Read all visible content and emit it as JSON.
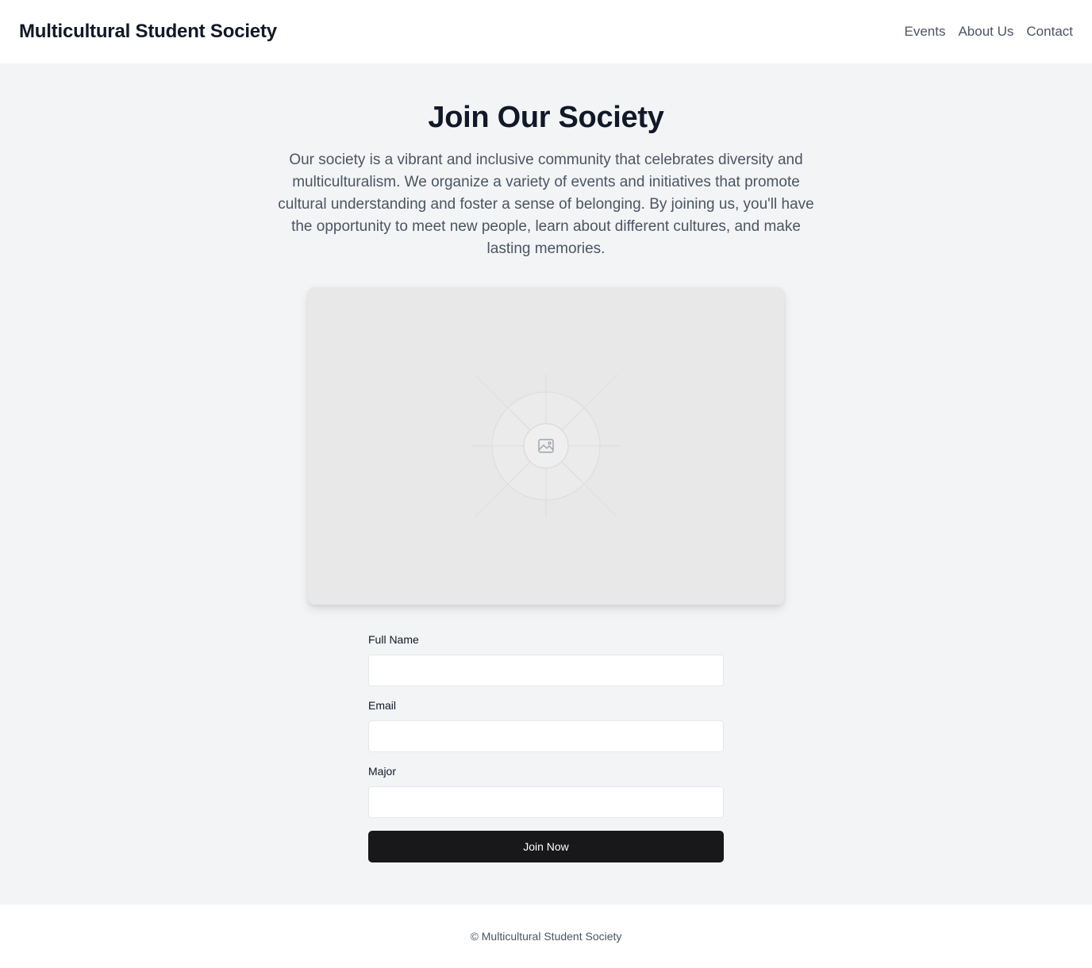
{
  "header": {
    "brand": "Multicultural Student Society",
    "nav": [
      {
        "label": "Events"
      },
      {
        "label": "About Us"
      },
      {
        "label": "Contact"
      }
    ]
  },
  "main": {
    "title": "Join Our Society",
    "description": "Our society is a vibrant and inclusive community that celebrates diversity and multiculturalism. We organize a variety of events and initiatives that promote cultural understanding and foster a sense of belonging. By joining us, you'll have the opportunity to meet new people, learn about different cultures, and make lasting memories.",
    "image": {
      "icon": "image-placeholder-icon"
    },
    "form": {
      "fields": [
        {
          "label": "Full Name",
          "value": "",
          "placeholder": ""
        },
        {
          "label": "Email",
          "value": "",
          "placeholder": ""
        },
        {
          "label": "Major",
          "value": "",
          "placeholder": ""
        }
      ],
      "submit_label": "Join Now"
    }
  },
  "footer": {
    "text": "© Multicultural Student Society"
  },
  "colors": {
    "page_bg": "#f3f4f6",
    "header_bg": "#ffffff",
    "button_bg": "#18181b",
    "heading": "#111827",
    "muted_text": "#4b5563"
  }
}
